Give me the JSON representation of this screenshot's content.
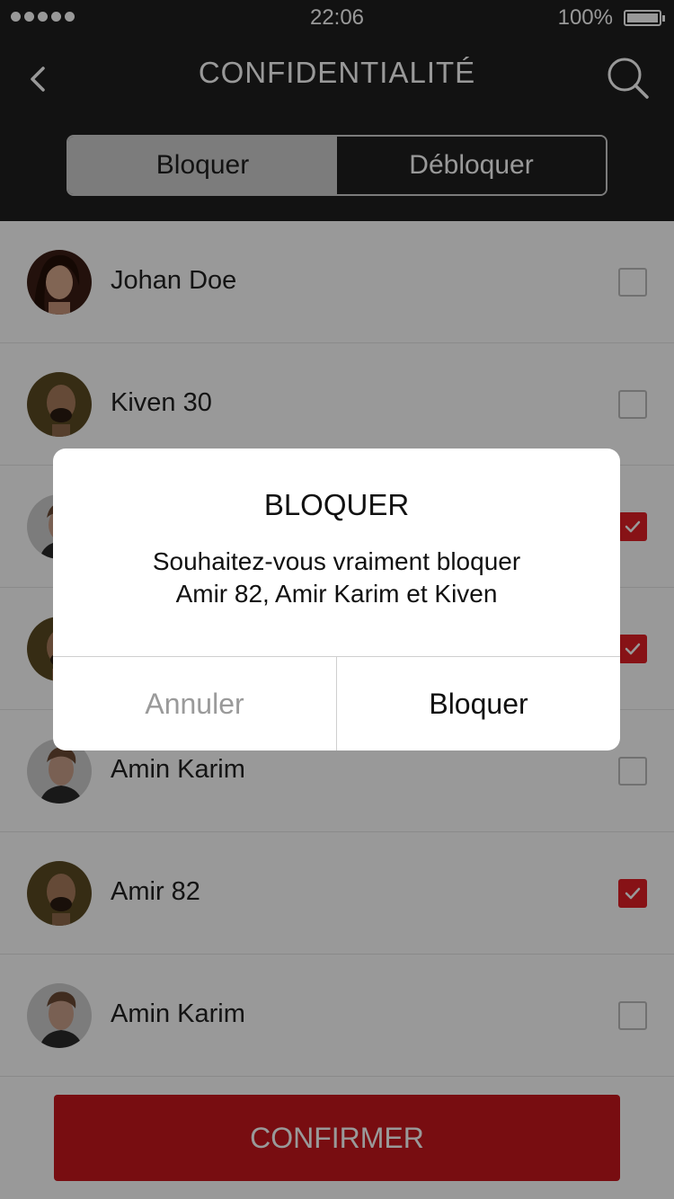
{
  "status_bar": {
    "time": "22:06",
    "battery": "100%"
  },
  "header": {
    "title": "CONFIDENTIALITÉ"
  },
  "segments": {
    "left": "Bloquer",
    "right": "Débloquer"
  },
  "contacts": [
    {
      "name": "Johan Doe",
      "checked": false,
      "avatar": "woman"
    },
    {
      "name": "Kiven 30",
      "checked": false,
      "avatar": "bald-man"
    },
    {
      "name": "",
      "checked": true,
      "avatar": "man"
    },
    {
      "name": "",
      "checked": true,
      "avatar": "bald-man"
    },
    {
      "name": "Amin Karim",
      "checked": false,
      "avatar": "man"
    },
    {
      "name": "Amir 82",
      "checked": true,
      "avatar": "bald-man"
    },
    {
      "name": "Amin Karim",
      "checked": false,
      "avatar": "man"
    }
  ],
  "confirm_label": "CONFIRMER",
  "dialog": {
    "title": "BLOQUER",
    "message_line1": "Souhaitez-vous vraiment bloquer",
    "message_line2": "Amir 82, Amir Karim et Kiven",
    "cancel": "Annuler",
    "confirm": "Bloquer"
  },
  "colors": {
    "accent": "#e21f26",
    "header_bg": "#1f1f1f",
    "confirm_bg": "#c8171d"
  }
}
